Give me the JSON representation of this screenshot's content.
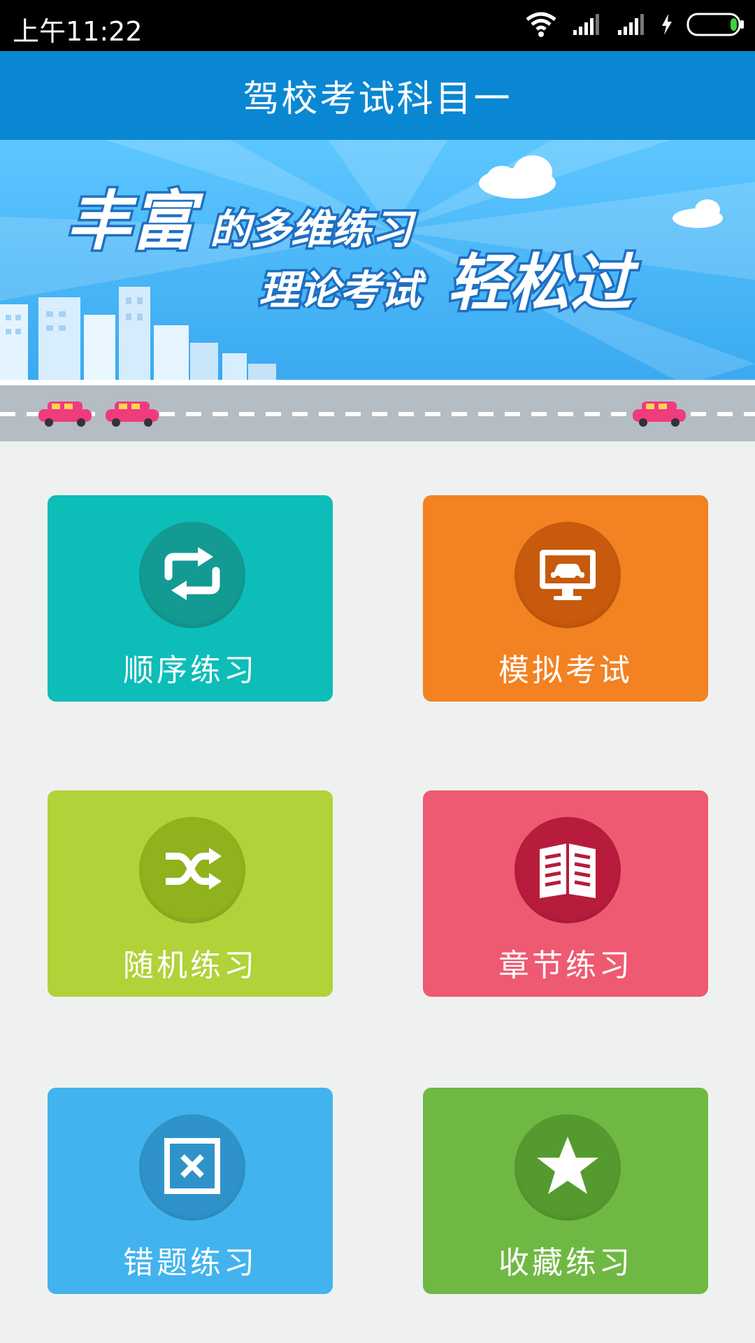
{
  "status_bar": {
    "time": "上午11:22",
    "icons": [
      "wifi-icon",
      "signal-icon",
      "signal-icon",
      "charging-icon",
      "battery-icon"
    ]
  },
  "app_bar": {
    "title": "驾校考试科目一"
  },
  "banner": {
    "headline_line1_big": "丰富",
    "headline_line1_small": "的多维练习",
    "headline_line2_small": "理论考试",
    "headline_line2_big": "轻松过"
  },
  "tiles": [
    {
      "label": "顺序练习",
      "icon": "repeat-icon",
      "color": "#0dbdb8",
      "circle": "#139a93"
    },
    {
      "label": "模拟考试",
      "icon": "monitor-car-icon",
      "color": "#f28222",
      "circle": "#c75a0c"
    },
    {
      "label": "随机练习",
      "icon": "shuffle-icon",
      "color": "#b1d239",
      "circle": "#8fb21d"
    },
    {
      "label": "章节练习",
      "icon": "book-icon",
      "color": "#ee5a72",
      "circle": "#b81c3c"
    },
    {
      "label": "错题练习",
      "icon": "wrong-box-icon",
      "color": "#42b3ee",
      "circle": "#2f93c9"
    },
    {
      "label": "收藏练习",
      "icon": "star-icon",
      "color": "#70b844",
      "circle": "#559a2f"
    }
  ],
  "colors": {
    "app_bar": "#0a87d3",
    "background": "#eff1f0"
  }
}
